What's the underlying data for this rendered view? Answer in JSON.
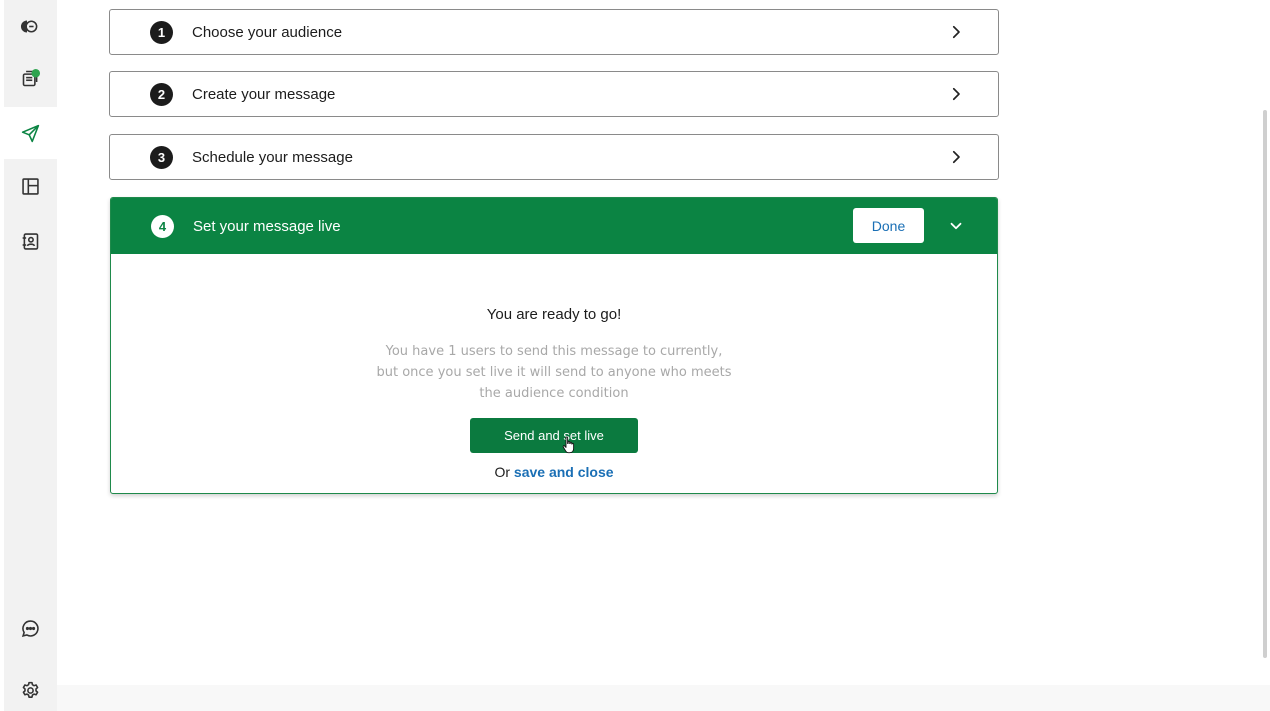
{
  "sidebar": {
    "items": [
      {
        "id": "conversations",
        "icon": "chat-bubbles-icon"
      },
      {
        "id": "inbox",
        "icon": "inbox-badge-icon"
      },
      {
        "id": "messages",
        "icon": "send-icon"
      },
      {
        "id": "layouts",
        "icon": "layout-icon"
      },
      {
        "id": "contacts",
        "icon": "contact-book-icon"
      },
      {
        "id": "help",
        "icon": "chat-dots-icon"
      },
      {
        "id": "settings",
        "icon": "gear-icon"
      }
    ],
    "active": "messages"
  },
  "steps": [
    {
      "number": "1",
      "title": "Choose your audience"
    },
    {
      "number": "2",
      "title": "Create your message"
    },
    {
      "number": "3",
      "title": "Schedule your message"
    }
  ],
  "active_step": {
    "number": "4",
    "title": "Set your message live",
    "done_label": "Done",
    "heading": "You are ready to go!",
    "description": "You have 1 users to send this message to currently, but once you set live it will send to anyone who meets the audience condition",
    "primary_button": "Send and set live",
    "alt_prefix": "Or",
    "alt_link": "save and close"
  },
  "colors": {
    "brand_green": "#0b8443",
    "link_blue": "#1a6fb5"
  }
}
